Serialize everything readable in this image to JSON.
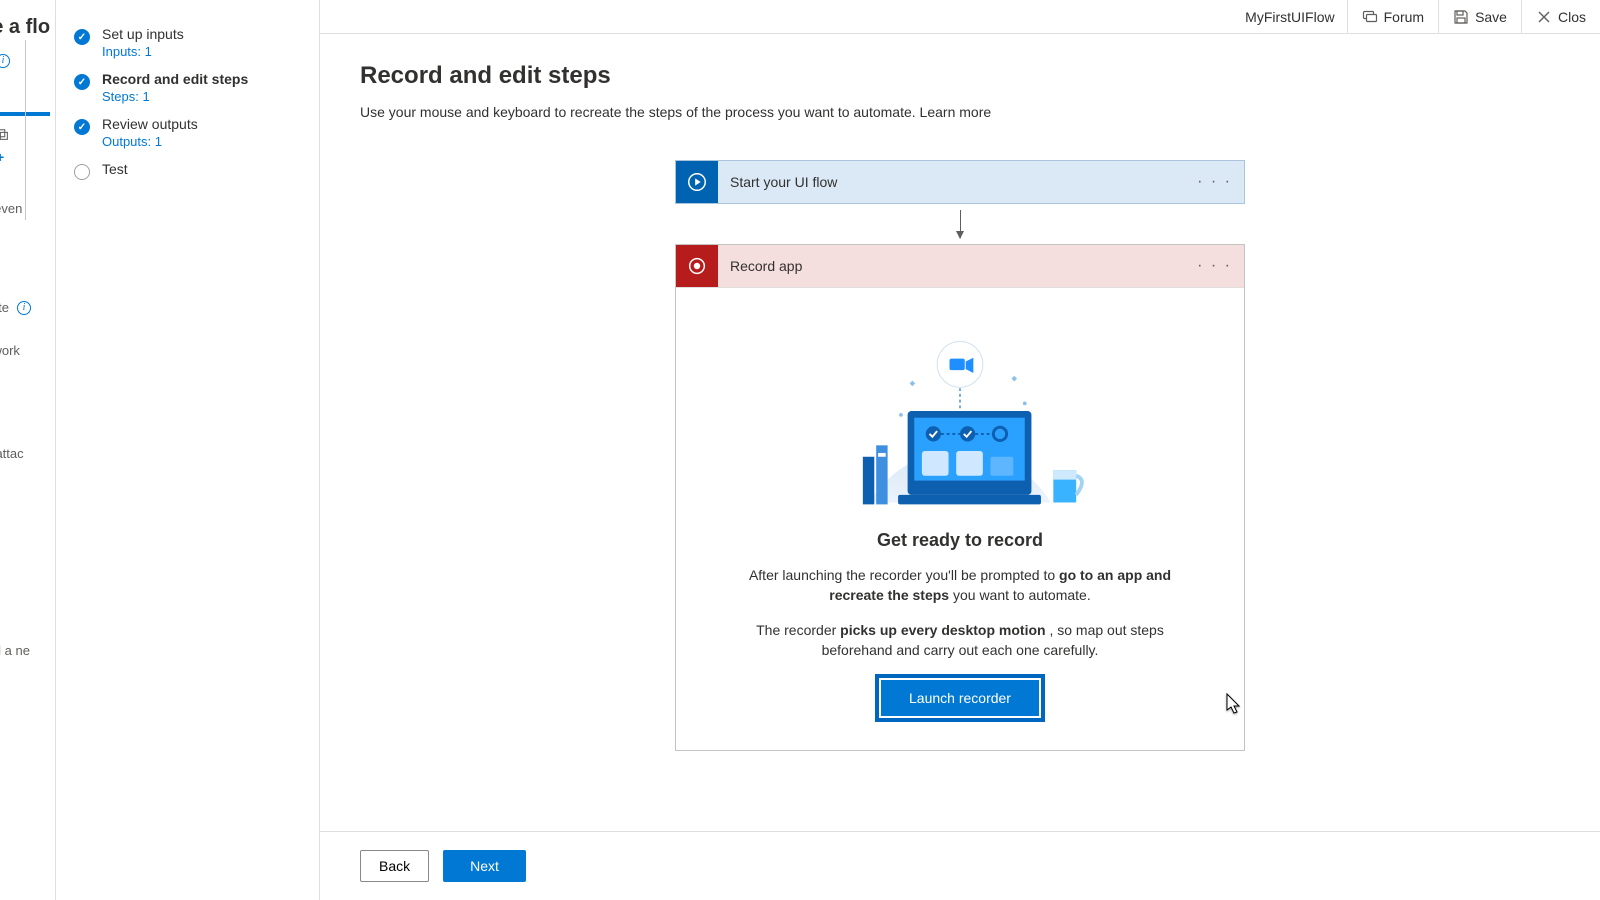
{
  "left_rail": {
    "top_title": "ake a flo",
    "snippet_events": "nated even",
    "snippet_late": "late",
    "snippet_work": "te work",
    "snippet_attach": "mail attac",
    "snippet_email": "email a ne"
  },
  "steps": [
    {
      "label": "Set up inputs",
      "sub": "Inputs: 1",
      "done": true,
      "active": false
    },
    {
      "label": "Record and edit steps",
      "sub": "Steps: 1",
      "done": true,
      "active": true
    },
    {
      "label": "Review outputs",
      "sub": "Outputs: 1",
      "done": true,
      "active": false
    },
    {
      "label": "Test",
      "sub": "",
      "done": false,
      "active": false
    }
  ],
  "topbar": {
    "flow_name": "MyFirstUIFlow",
    "forum": "Forum",
    "save": "Save",
    "close": "Clos"
  },
  "page": {
    "title": "Record and edit steps",
    "subtitle": "Use your mouse and keyboard to recreate the steps of the process you want to automate.  ",
    "learn_more": "Learn more"
  },
  "flow_cards": {
    "start": {
      "title": "Start your UI flow"
    },
    "record": {
      "title": "Record app"
    }
  },
  "record_panel": {
    "heading": "Get ready to record",
    "p1_lead": "After launching the recorder you'll be prompted to ",
    "p1_bold": "go to an app and recreate the steps",
    "p1_tail": " you want to automate.",
    "p2_lead": "The recorder ",
    "p2_bold": "picks up every desktop motion",
    "p2_tail": ", so map out steps beforehand and carry out each one carefully.",
    "launch_label": "Launch recorder"
  },
  "footer": {
    "back": "Back",
    "next": "Next"
  }
}
